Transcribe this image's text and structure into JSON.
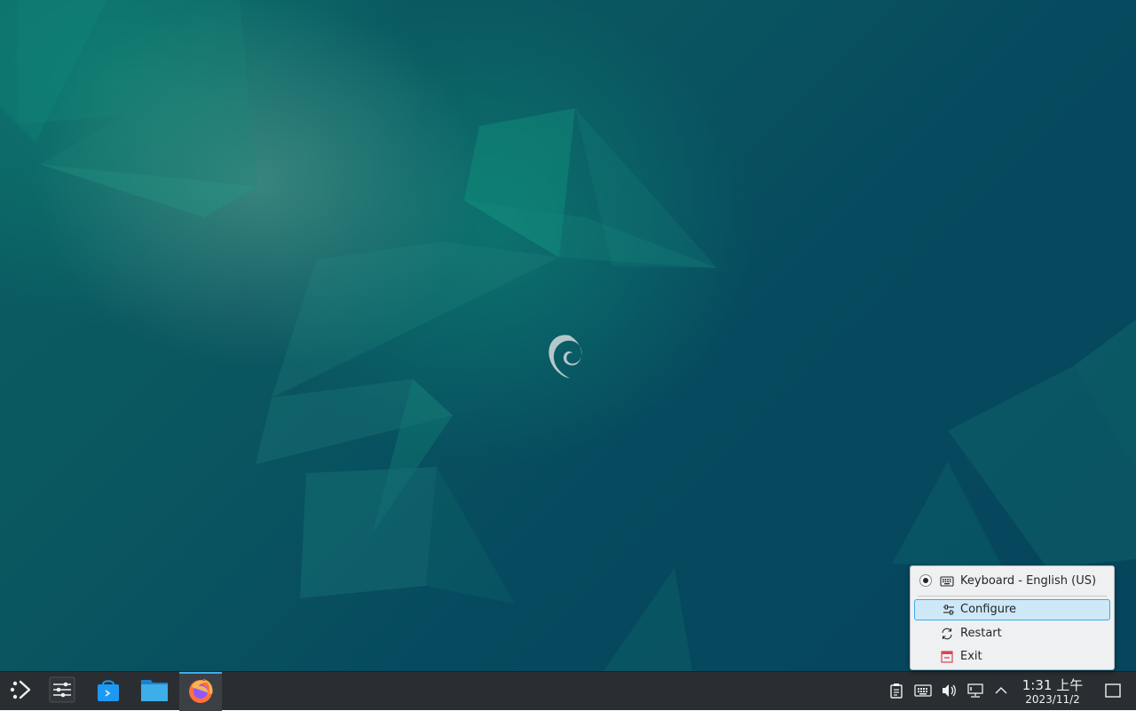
{
  "desktop": {
    "wallpaper": "debian-emerald-wallpaper",
    "logo": "debian-swirl-icon"
  },
  "taskbar": {
    "launcher_icon": "application-launcher-icon",
    "apps": [
      {
        "name": "system-settings-icon"
      },
      {
        "name": "discover-store-icon"
      },
      {
        "name": "file-manager-icon"
      },
      {
        "name": "firefox-icon",
        "active": true
      }
    ],
    "tray": [
      "clipboard-icon",
      "keyboard-icon",
      "volume-icon",
      "network-icon",
      "show-hidden-icons-chevron"
    ],
    "clock": {
      "time": "1:31 上午",
      "date": "2023/11/2"
    },
    "show_desktop_icon": "show-desktop-icon"
  },
  "context_menu": {
    "keyboard_item": "Keyboard - English (US)",
    "configure": "Configure",
    "restart": "Restart",
    "exit": "Exit"
  },
  "colors": {
    "accent": "#3daee9",
    "taskbar_bg": "#2a2e32",
    "menu_bg": "#eff0f1",
    "highlight_bg": "#cde8f7",
    "exit_icon": "#da4453"
  }
}
